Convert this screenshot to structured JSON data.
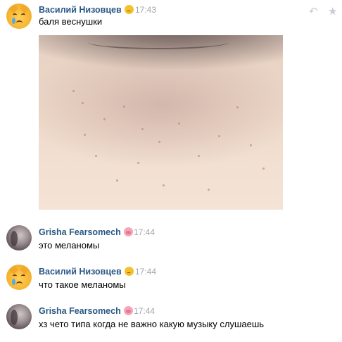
{
  "messages": [
    {
      "author": "Василий Низовцев",
      "time": "17:43",
      "text": "баля веснушки",
      "avatar_icon": "crying-cat-avatar",
      "emoji_icon": "sad-face-emoji"
    },
    {
      "author": "Grisha Fearsomech",
      "time": "17:44",
      "text": "это меланомы",
      "avatar_icon": "user-photo-avatar",
      "emoji_icon": "pig-face-emoji"
    },
    {
      "author": "Василий Низовцев",
      "time": "17:44",
      "text": "что такое меланомы",
      "avatar_icon": "crying-cat-avatar",
      "emoji_icon": "sad-face-emoji"
    },
    {
      "author": "Grisha Fearsomech",
      "time": "17:44",
      "text": "хз чето типа когда не важно какую музыку слушаешь",
      "avatar_icon": "user-photo-avatar",
      "emoji_icon": "pig-face-emoji"
    }
  ],
  "toolbar": {
    "reply_icon": "reply-icon",
    "favorite_icon": "star-icon"
  },
  "colors": {
    "author_name": "#2a5885",
    "timestamp": "#a0a7ad",
    "toolbar_icon": "#c5cbd3"
  }
}
